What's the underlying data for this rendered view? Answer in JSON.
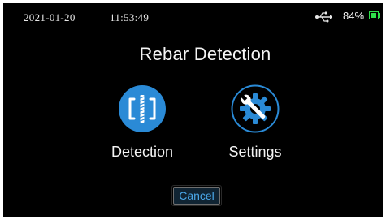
{
  "status_bar": {
    "date": "2021-01-20",
    "time": "11:53:49",
    "usb_icon": "usb-icon",
    "battery_percent": "84%",
    "battery_level": 0.84,
    "battery_color": "#2fe04a"
  },
  "title": "Rebar Detection",
  "menu": [
    {
      "label": "Detection",
      "icon": "rebar-detection-icon",
      "color": "#2a8ad6"
    },
    {
      "label": "Settings",
      "icon": "settings-gear-wrench-icon",
      "color": "#2a8ad6"
    }
  ],
  "cancel_label": "Cancel",
  "colors": {
    "background": "#000000",
    "accent": "#2a8ad6",
    "cancel_text": "#4aa7e8"
  }
}
